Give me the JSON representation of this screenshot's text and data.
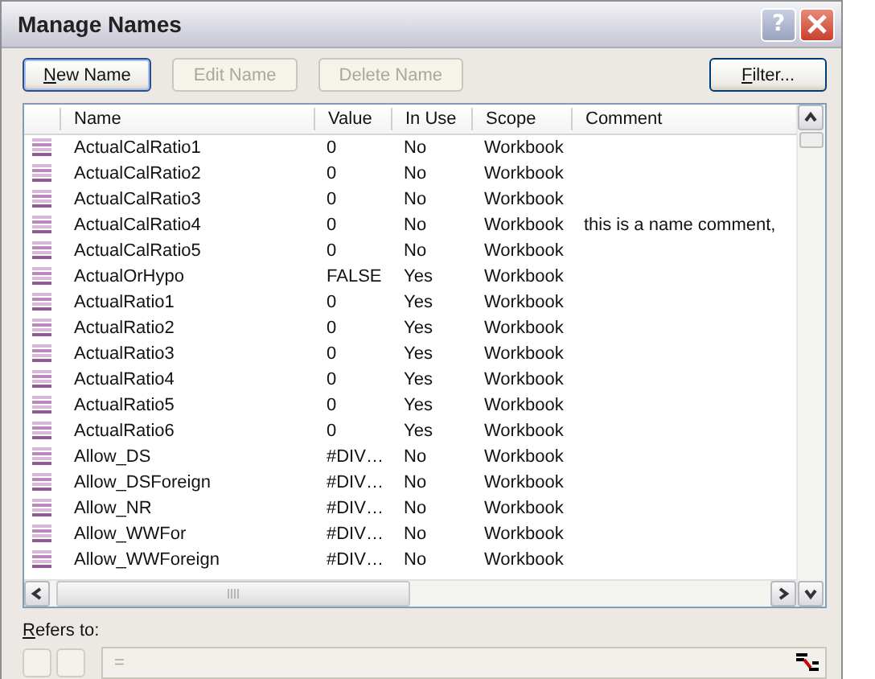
{
  "window": {
    "title": "Manage Names",
    "help": "?"
  },
  "buttons": [
    {
      "label": "New Name",
      "disabled": false,
      "accelerator": true
    },
    {
      "label": "Edit Name",
      "disabled": true,
      "accelerator": false
    },
    {
      "label": "Delete Name",
      "disabled": true,
      "accelerator": false
    }
  ],
  "filter_button": {
    "label": "Filter...",
    "accelerator": true
  },
  "table": {
    "columns": [
      "Name",
      "Value",
      "In Use",
      "Scope",
      "Comment"
    ],
    "rows": [
      {
        "name": "ActualCalRatio1",
        "value": "0",
        "in_use": "No",
        "scope": "Workbook"
      },
      {
        "name": "ActualCalRatio2",
        "value": "0",
        "in_use": "No",
        "scope": "Workbook"
      },
      {
        "name": "ActualCalRatio3",
        "value": "0",
        "in_use": "No",
        "scope": "Workbook"
      },
      {
        "name": "ActualCalRatio4",
        "value": "0",
        "in_use": "No",
        "scope": "Workbook",
        "comment": "this is a name comment,"
      },
      {
        "name": "ActualCalRatio5",
        "value": "0",
        "in_use": "No",
        "scope": "Workbook"
      },
      {
        "name": "ActualOrHypo",
        "value": "FALSE",
        "in_use": "Yes",
        "scope": "Workbook"
      },
      {
        "name": "ActualRatio1",
        "value": "0",
        "in_use": "Yes",
        "scope": "Workbook"
      },
      {
        "name": "ActualRatio2",
        "value": "0",
        "in_use": "Yes",
        "scope": "Workbook"
      },
      {
        "name": "ActualRatio3",
        "value": "0",
        "in_use": "Yes",
        "scope": "Workbook"
      },
      {
        "name": "ActualRatio4",
        "value": "0",
        "in_use": "Yes",
        "scope": "Workbook"
      },
      {
        "name": "ActualRatio5",
        "value": "0",
        "in_use": "Yes",
        "scope": "Workbook"
      },
      {
        "name": "ActualRatio6",
        "value": "0",
        "in_use": "Yes",
        "scope": "Workbook"
      },
      {
        "name": "Allow_DS",
        "value": "#DIV…",
        "in_use": "No",
        "scope": "Workbook"
      },
      {
        "name": "Allow_DSForeign",
        "value": "#DIV…",
        "in_use": "No",
        "scope": "Workbook"
      },
      {
        "name": "Allow_NR",
        "value": "#DIV…",
        "in_use": "No",
        "scope": "Workbook"
      },
      {
        "name": "Allow_WWFor",
        "value": "#DIV…",
        "in_use": "No",
        "scope": "Workbook"
      },
      {
        "name": "Allow_WWForeign",
        "value": "#DIV…",
        "in_use": "No",
        "scope": "Workbook"
      }
    ]
  },
  "refers_to": {
    "label": "Refers to:",
    "accelerator": true,
    "value": "=",
    "disabled": true
  }
}
